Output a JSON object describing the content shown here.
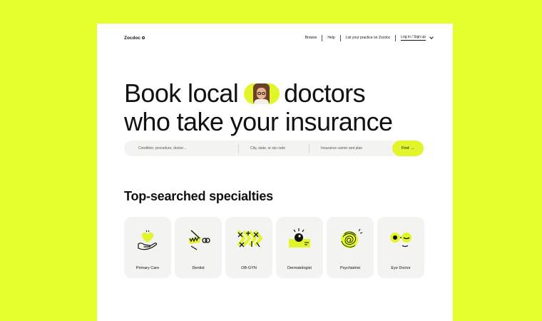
{
  "nav": {
    "logo": "Zocdoc",
    "links": [
      "Browse",
      "Help",
      "List your practice on Zocdoc"
    ],
    "login": "Log in / Sign up"
  },
  "hero": {
    "line1_a": "Book local",
    "line1_b": "doctors",
    "line2": "who take your insurance"
  },
  "search": {
    "condition_placeholder": "Condition, procedure, doctor...",
    "location_placeholder": "City, state, or zip code",
    "insurance_placeholder": "Insurance carrier and plan",
    "find_label": "Find",
    "find_arrow": "→"
  },
  "specialties": {
    "title": "Top-searched specialties",
    "items": [
      {
        "label": "Primary Care",
        "icon": "hand-heart-icon"
      },
      {
        "label": "Dentist",
        "icon": "tooth-tool-icon"
      },
      {
        "label": "OB-GYN",
        "icon": "pattern-icon"
      },
      {
        "label": "Dermatologist",
        "icon": "eye-patch-icon"
      },
      {
        "label": "Psychiatrist",
        "icon": "scribble-icon"
      },
      {
        "label": "Eye Doctor",
        "icon": "glasses-icon"
      }
    ]
  },
  "colors": {
    "accent": "#e1f52a",
    "background": "#e5ff2e",
    "tile": "#f3f3f1",
    "text": "#111111"
  }
}
